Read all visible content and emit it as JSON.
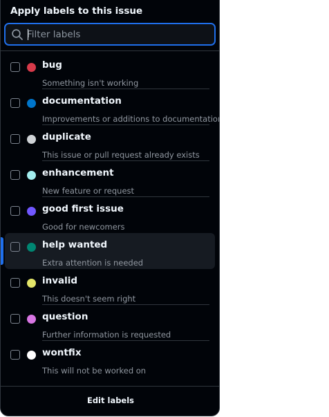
{
  "panel": {
    "title": "Apply labels to this issue"
  },
  "filter": {
    "placeholder": "Filter labels",
    "value": ""
  },
  "labels": [
    {
      "name": "bug",
      "description": "Something isn't working",
      "color": "#d73a4a",
      "checked": false,
      "active": false
    },
    {
      "name": "documentation",
      "description": "Improvements or additions to documentation",
      "color": "#0075ca",
      "checked": false,
      "active": false
    },
    {
      "name": "duplicate",
      "description": "This issue or pull request already exists",
      "color": "#cfd3d7",
      "checked": false,
      "active": false
    },
    {
      "name": "enhancement",
      "description": "New feature or request",
      "color": "#a2eeef",
      "checked": false,
      "active": false
    },
    {
      "name": "good first issue",
      "description": "Good for newcomers",
      "color": "#7057ff",
      "checked": false,
      "active": false
    },
    {
      "name": "help wanted",
      "description": "Extra attention is needed",
      "color": "#008672",
      "checked": false,
      "active": true
    },
    {
      "name": "invalid",
      "description": "This doesn't seem right",
      "color": "#e4e669",
      "checked": false,
      "active": false
    },
    {
      "name": "question",
      "description": "Further information is requested",
      "color": "#d876e3",
      "checked": false,
      "active": false
    },
    {
      "name": "wontfix",
      "description": "This will not be worked on",
      "color": "#ffffff",
      "checked": false,
      "active": false
    }
  ],
  "footer": {
    "edit_label": "Edit labels"
  },
  "icons": {
    "search": "search-icon"
  },
  "colors": {
    "background": "#010409",
    "accent": "#1f6feb",
    "text": "#f0f6fc",
    "muted_text": "#9198a1"
  }
}
